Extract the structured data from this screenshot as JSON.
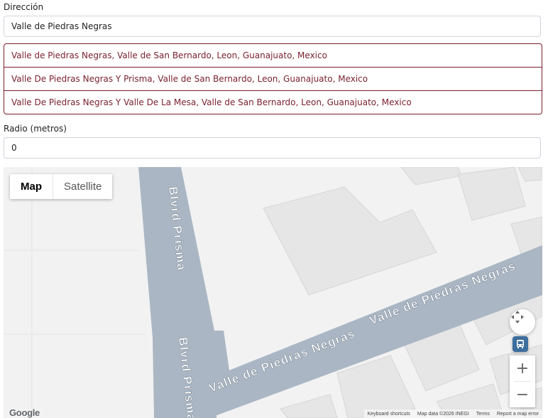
{
  "form": {
    "address_label": "Dirección",
    "address_value": "Valle de Piedras Negras",
    "suggestions": [
      "Valle de Piedras Negras, Valle de San Bernardo, Leon, Guanajuato, Mexico",
      "Valle De Piedras Negras Y Prisma, Valle de San Bernardo, Leon, Guanajuato, Mexico",
      "Valle De Piedras Negras Y Valle De La Mesa, Valle de San Bernardo, Leon, Guanajuato, Mexico"
    ],
    "radius_label": "Radio (metros)",
    "radius_value": "0"
  },
  "map": {
    "type_map": "Map",
    "type_satellite": "Satellite",
    "street_labels": {
      "blvd_top": "Blvrd Prisma",
      "blvd_bottom": "Blvrd Prisma",
      "valle_right": "Valle de Piedras Negras",
      "valle_left": "Valle de Piedras Negras"
    },
    "logo": "Google",
    "footer": {
      "shortcuts": "Keyboard shortcuts",
      "mapdata": "Map data ©2026 INEGI",
      "terms": "Terms",
      "report": "Report a map error"
    },
    "colors": {
      "road": "#aab6c3",
      "building": "#e6e6e6",
      "background": "#f2f2f2",
      "accent": "#7a1f2e"
    }
  }
}
